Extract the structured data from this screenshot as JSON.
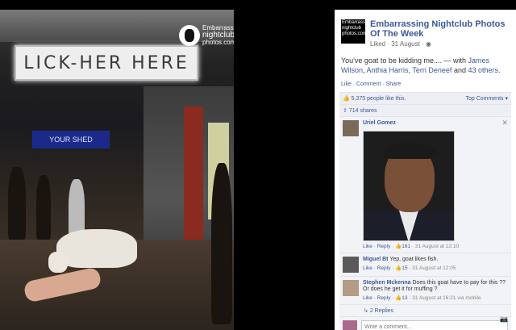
{
  "photo": {
    "sign_text": "LICK-HER HERE",
    "blue_sign_text": "YOUR SHED",
    "watermark": {
      "line1": "Embarrassing",
      "line2": "nightclub",
      "line3": "photos.com"
    }
  },
  "post": {
    "page_logo_text": "Embarrassing nightclub photos.com",
    "page_name": "Embarrassing Nightclub Photos Of The Week",
    "meta": "Liked · 31 August ·",
    "caption_prefix": "You've goat to be kidding me.... — with ",
    "tags": [
      "James Wilson",
      "Anthia Harris",
      "Terri Deneef"
    ],
    "and_text": " and ",
    "others": "43 others",
    "actions": "Like · Comment · Share",
    "likes_text": "5,375 people like this.",
    "top_comments": "Top Comments ▾",
    "shares_text": "714 shares"
  },
  "comments": [
    {
      "name": "Uriel Gomez",
      "text": "",
      "meta_like": "Like",
      "meta_reply": "Reply",
      "meta_count": "161",
      "meta_time": "31 August at 12:10"
    },
    {
      "name": "Miguel Bt",
      "text": "Yep, goat likes fish.",
      "meta_like": "Like",
      "meta_reply": "Reply",
      "meta_count": "15",
      "meta_time": "31 August at 12:05"
    },
    {
      "name": "Stephen Mckenna",
      "text": "Does this goat have to pay for this ?? Or does he get it for muffing ?",
      "meta_like": "Like",
      "meta_reply": "Reply",
      "meta_count": "13",
      "meta_time": "31 August at 16:21 via mobile"
    }
  ],
  "replies_text": "2 Replies",
  "write_placeholder": "Write a comment...",
  "colors": {
    "link": "#3b5998",
    "bg_panel": "#ffffff"
  }
}
